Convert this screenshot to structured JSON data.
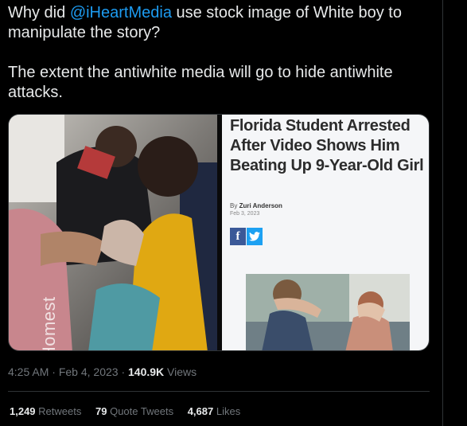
{
  "tweet": {
    "line1_prefix": "Why did ",
    "mention": "@iHeartMedia",
    "line1_suffix": " use stock image of White boy to manipulate the story?",
    "paragraph2": "The extent the antiwhite media will go to hide antiwhite attacks."
  },
  "media": {
    "watermark": "@Homest",
    "article": {
      "headline": "Florida Student Arrested After Video Shows Him Beating Up 9-Year-Old Girl",
      "by_prefix": "By ",
      "author": "Zuri Anderson",
      "date": "Feb 3, 2023",
      "share_facebook_glyph": "f",
      "share_twitter_icon": "twitter-bird-icon"
    }
  },
  "meta": {
    "time": "4:25 AM",
    "separator": " · ",
    "date": "Feb 4, 2023",
    "views_count": "140.9K",
    "views_label": " Views"
  },
  "stats": {
    "retweets_count": "1,249",
    "retweets_label": "Retweets",
    "quotes_count": "79",
    "quotes_label": "Quote Tweets",
    "likes_count": "4,687",
    "likes_label": "Likes"
  },
  "colors": {
    "background": "#000000",
    "text": "#e7e9ea",
    "link": "#1d9bf0",
    "muted": "#71767b",
    "divider": "#2f3336",
    "facebook": "#3b5998",
    "twitter": "#1da1f2"
  }
}
